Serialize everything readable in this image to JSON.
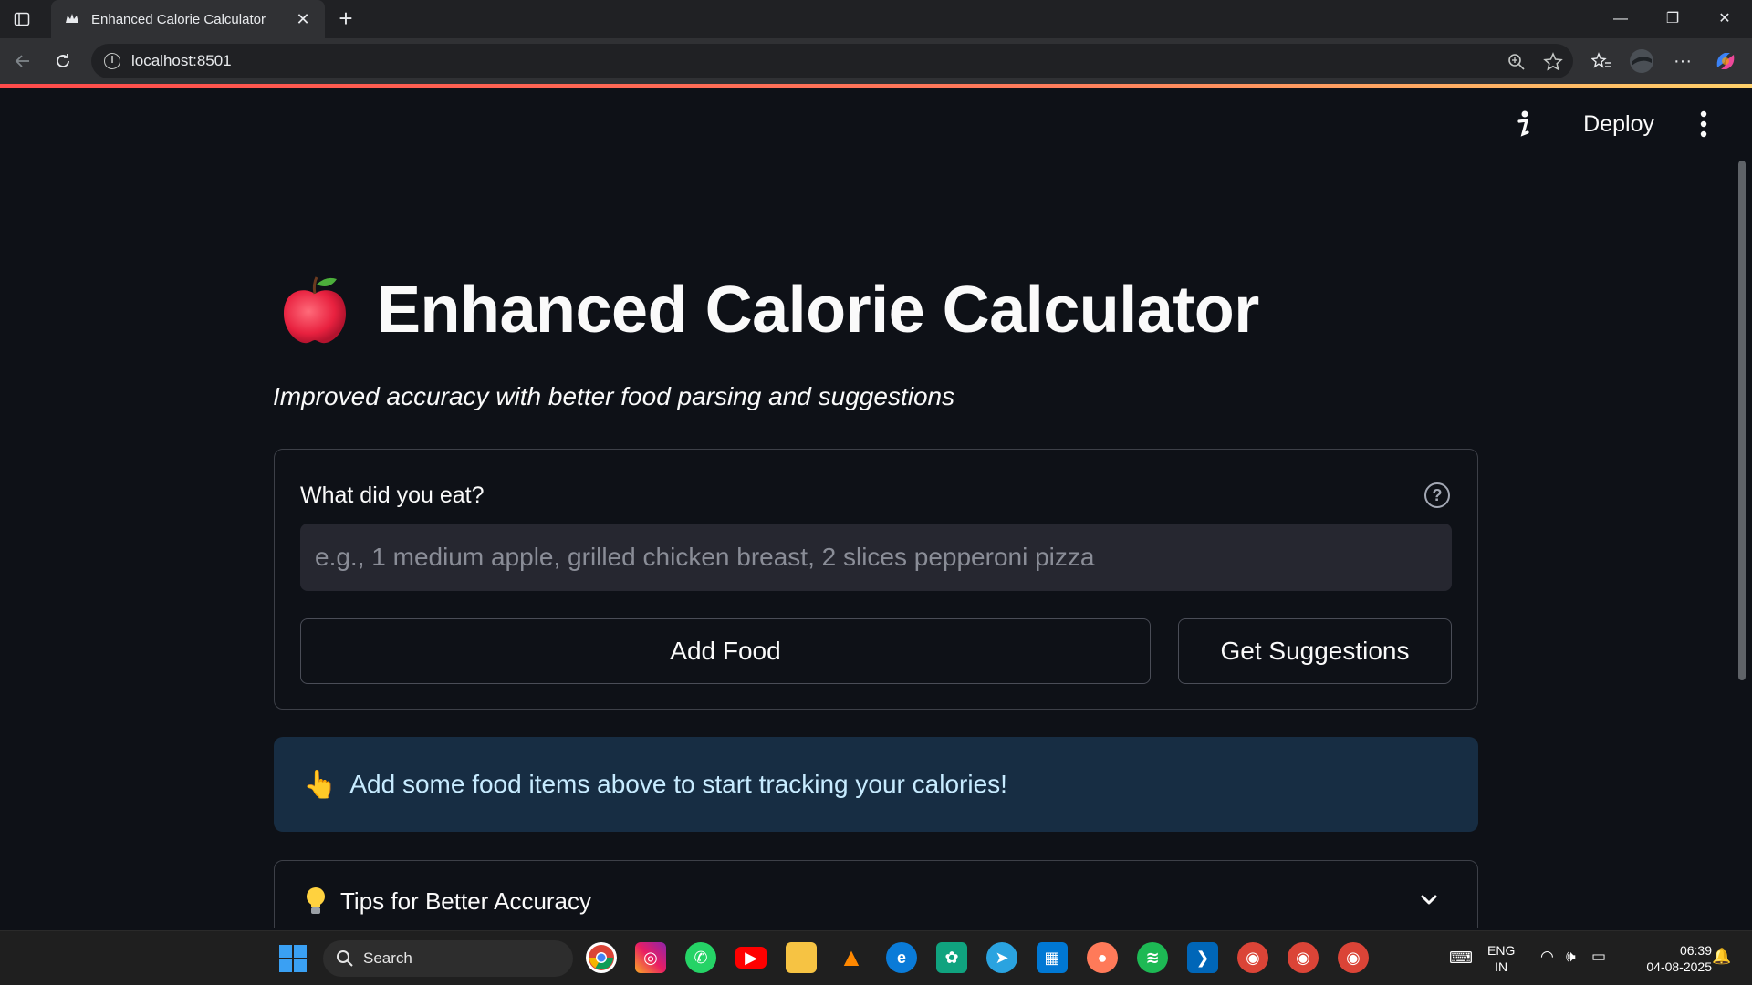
{
  "browser": {
    "tab_title": "Enhanced Calorie Calculator",
    "url": "localhost:8501"
  },
  "app_header": {
    "deploy_label": "Deploy"
  },
  "main": {
    "title": "Enhanced Calorie Calculator",
    "subtitle": "Improved accuracy with better food parsing and suggestions",
    "form": {
      "label": "What did you eat?",
      "placeholder": "e.g., 1 medium apple, grilled chicken breast, 2 slices pepperoni pizza",
      "add_button": "Add Food",
      "suggest_button": "Get Suggestions"
    },
    "info": {
      "emoji": "👆",
      "text": "Add some food items above to start tracking your calories!"
    },
    "expander": {
      "label": "Tips for Better Accuracy"
    }
  },
  "taskbar": {
    "search_label": "Search",
    "lang_line1": "ENG",
    "lang_line2": "IN",
    "time": "06:39",
    "date": "04-08-2025"
  },
  "colors": {
    "accent": "#ff4b4b",
    "info_bg": "#172d43",
    "info_text": "#c7ebff"
  }
}
